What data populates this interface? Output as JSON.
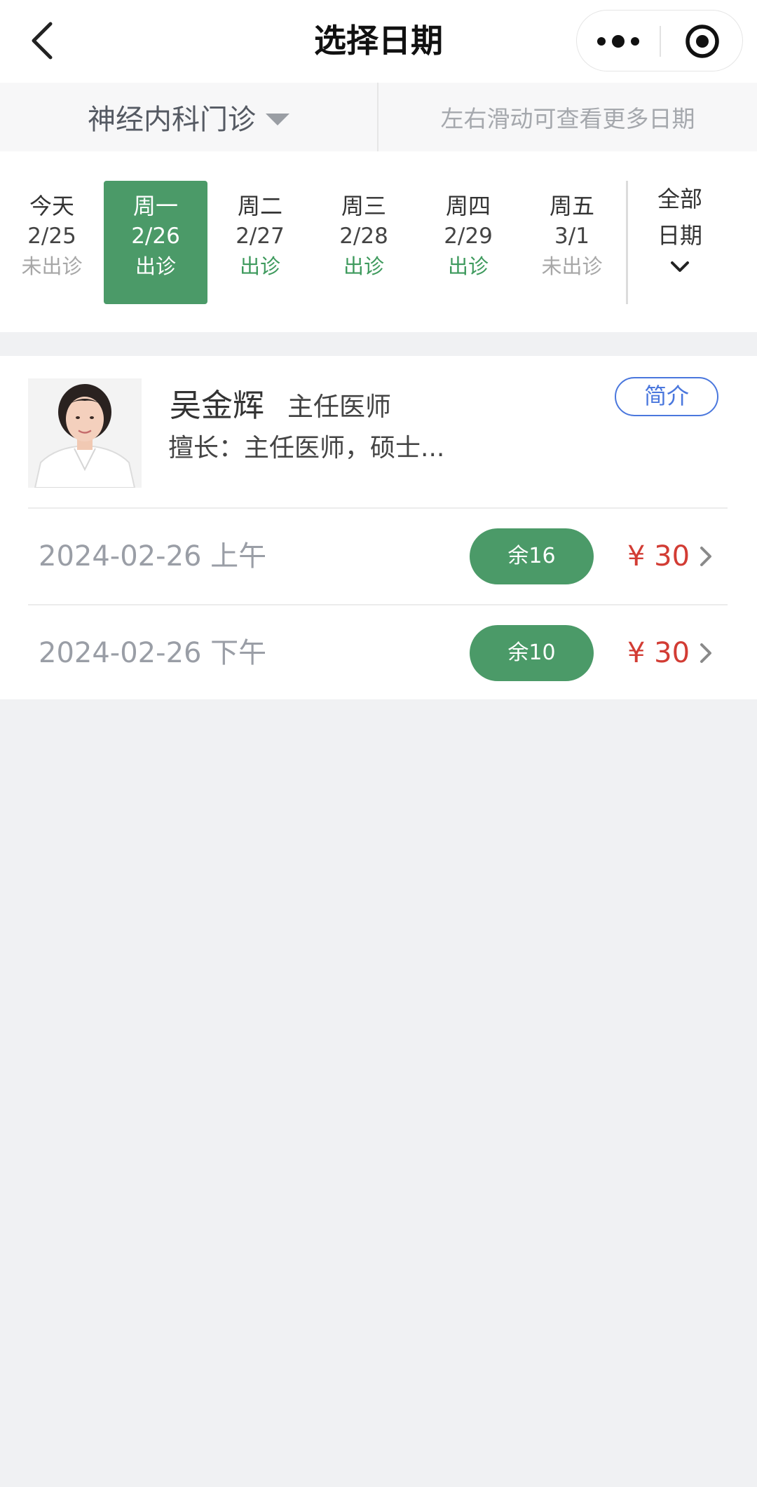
{
  "nav": {
    "title": "选择日期",
    "back_icon": "chevron-left-icon",
    "more_icon": "more-dots-icon",
    "record_icon": "target-circle-icon"
  },
  "dept": {
    "name": "神经内科门诊",
    "hint": "左右滑动可查看更多日期"
  },
  "dates": [
    {
      "weekday": "今天",
      "date": "2/25",
      "status": "未出诊"
    },
    {
      "weekday": "周一",
      "date": "2/26",
      "status": "出诊"
    },
    {
      "weekday": "周二",
      "date": "2/27",
      "status": "出诊"
    },
    {
      "weekday": "周三",
      "date": "2/28",
      "status": "出诊"
    },
    {
      "weekday": "周四",
      "date": "2/29",
      "status": "出诊"
    },
    {
      "weekday": "周五",
      "date": "3/1",
      "status": "未出诊"
    }
  ],
  "all_dates": {
    "line1": "全部",
    "line2": "日期"
  },
  "doctor": {
    "name": "吴金辉",
    "title": "主任医师",
    "skill": "擅长：主任医师，硕士...",
    "intro_label": "简介"
  },
  "slots": [
    {
      "time": "2024-02-26 上午",
      "remain": "余16",
      "price": "¥ 30"
    },
    {
      "time": "2024-02-26 下午",
      "remain": "余10",
      "price": "¥ 30"
    }
  ],
  "colors": {
    "accent_green": "#4b9a68",
    "price_red": "#d23c34",
    "intro_blue": "#4a77dd"
  }
}
